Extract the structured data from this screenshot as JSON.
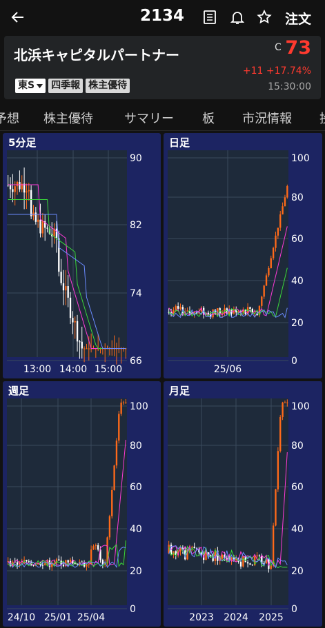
{
  "header": {
    "code": "2134",
    "order_label": "注文"
  },
  "stock": {
    "name": "北浜キャピタルパートナー",
    "price_flag": "C",
    "price": "73",
    "change": "+11 +17.74%",
    "time": "15:30:00",
    "market": "東S",
    "badges": [
      "四季報",
      "株主優待"
    ]
  },
  "tabs": [
    "予想",
    "株主優待",
    "サマリー",
    "板",
    "市況情報",
    "投"
  ],
  "colors": {
    "up": "#ff3a2f",
    "candle_up": "#ff6a1a",
    "candle_down": "#ffffff",
    "panel": "#1c2462",
    "plot": "#1e2a3a"
  },
  "charts": [
    {
      "title": "5分足",
      "y_labels": [
        "90",
        "82",
        "74",
        "66"
      ],
      "x_labels": [
        "13:00",
        "14:00",
        "15:00"
      ]
    },
    {
      "title": "日足",
      "y_labels": [
        "100",
        "80",
        "60",
        "40",
        "20",
        "0"
      ],
      "x_labels": [
        "25/06"
      ]
    },
    {
      "title": "週足",
      "y_labels": [
        "100",
        "80",
        "60",
        "40",
        "20",
        "0"
      ],
      "x_labels": [
        "24/10",
        "25/01",
        "25/04"
      ]
    },
    {
      "title": "月足",
      "y_labels": [
        "100",
        "80",
        "60",
        "40",
        "20",
        "0"
      ],
      "x_labels": [
        "2023",
        "2024",
        "2025"
      ]
    }
  ]
}
